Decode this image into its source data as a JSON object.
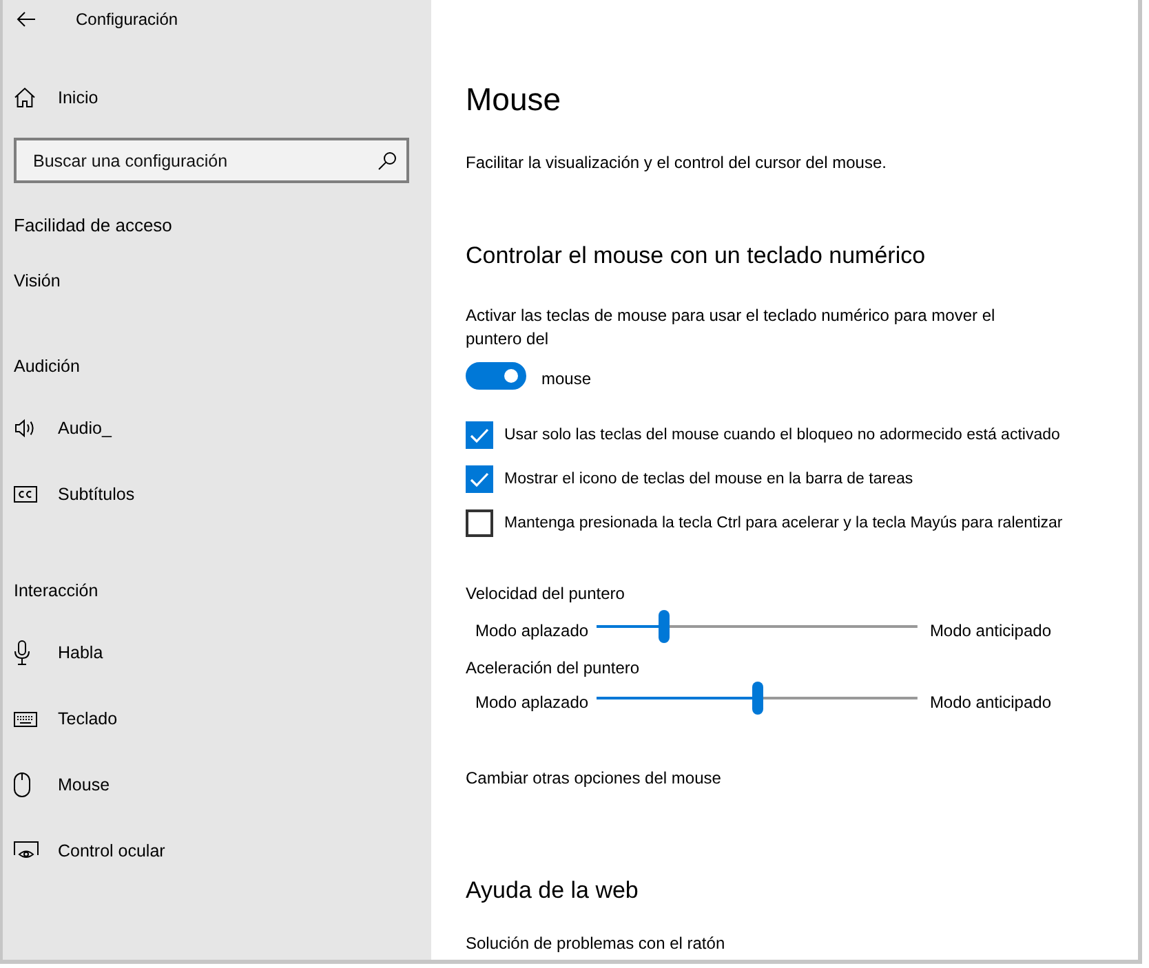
{
  "window": {
    "title": "Configuración"
  },
  "sidebar": {
    "home": "Inicio",
    "search": {
      "placeholder": "Buscar una configuración"
    },
    "section": "Facilidad de acceso",
    "groups": [
      {
        "heading": "Visión"
      },
      {
        "heading": "Audición",
        "items": [
          "Audio_",
          "Subtítulos"
        ]
      },
      {
        "heading": "Interacción",
        "items": [
          "Habla",
          "Teclado",
          "Mouse",
          "Control ocular"
        ]
      }
    ]
  },
  "main": {
    "title": "Mouse",
    "description": "Facilitar la visualización y el control del cursor del mouse.",
    "mouse_keys": {
      "heading": "Controlar el mouse con un teclado numérico",
      "toggle": {
        "description": "Activar las teclas de mouse para usar el teclado numérico para mover el puntero del",
        "label": "mouse",
        "on": true
      },
      "options": [
        {
          "label": "Usar solo las teclas del mouse cuando el bloqueo no adormecido está activado",
          "checked": true
        },
        {
          "label": "Mostrar el icono de teclas del mouse en la barra de tareas",
          "checked": true
        },
        {
          "label": "Mantenga presionada la tecla Ctrl para acelerar y la tecla Mayús para ralentizar",
          "checked": false
        }
      ],
      "sliders": [
        {
          "label": "Velocidad del puntero",
          "min_label": "Modo aplazado",
          "max_label": "Modo anticipado",
          "level": 0.21
        },
        {
          "label": "Aceleración del puntero",
          "min_label": "Modo aplazado",
          "max_label": "Modo anticipado",
          "level": 0.5
        }
      ]
    },
    "links": [
      "Cambiar otras opciones del mouse"
    ],
    "help": {
      "heading": "Ayuda de la web",
      "links": [
        "Solución de problemas con el ratón"
      ]
    }
  }
}
